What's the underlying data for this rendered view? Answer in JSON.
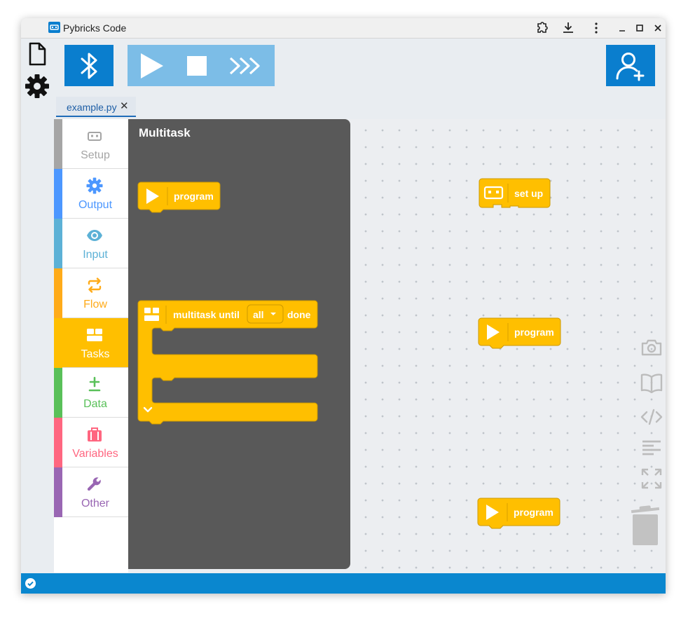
{
  "window": {
    "title": "Pybricks Code"
  },
  "tabs": [
    {
      "label": "example.py",
      "close": "✕"
    }
  ],
  "categories": [
    {
      "id": "setup",
      "label": "Setup",
      "color": "#a5a5a5"
    },
    {
      "id": "output",
      "label": "Output",
      "color": "#4c97ff"
    },
    {
      "id": "input",
      "label": "Input",
      "color": "#5cb1d6"
    },
    {
      "id": "flow",
      "label": "Flow",
      "color": "#ffab19"
    },
    {
      "id": "tasks",
      "label": "Tasks",
      "color": "#ffbf00",
      "selected": true
    },
    {
      "id": "data",
      "label": "Data",
      "color": "#59c059"
    },
    {
      "id": "variables",
      "label": "Variables",
      "color": "#ff6680"
    },
    {
      "id": "other",
      "label": "Other",
      "color": "#9966b3"
    }
  ],
  "flyout": {
    "title": "Multitask",
    "program_block": {
      "label": "program"
    },
    "multitask_block": {
      "prefix": "multitask until",
      "dropdown": "all",
      "suffix": "done"
    }
  },
  "workspace": {
    "setup_block": {
      "label": "set up"
    },
    "program_blocks": [
      {
        "label": "program"
      },
      {
        "label": "program"
      }
    ]
  },
  "colors": {
    "block": "#ffbf00",
    "block_border": "#cc9900",
    "accent": "#0a7ece",
    "accent_light": "#7cbde7",
    "flyout": "#595959",
    "statusbar": "#0a87cf"
  }
}
